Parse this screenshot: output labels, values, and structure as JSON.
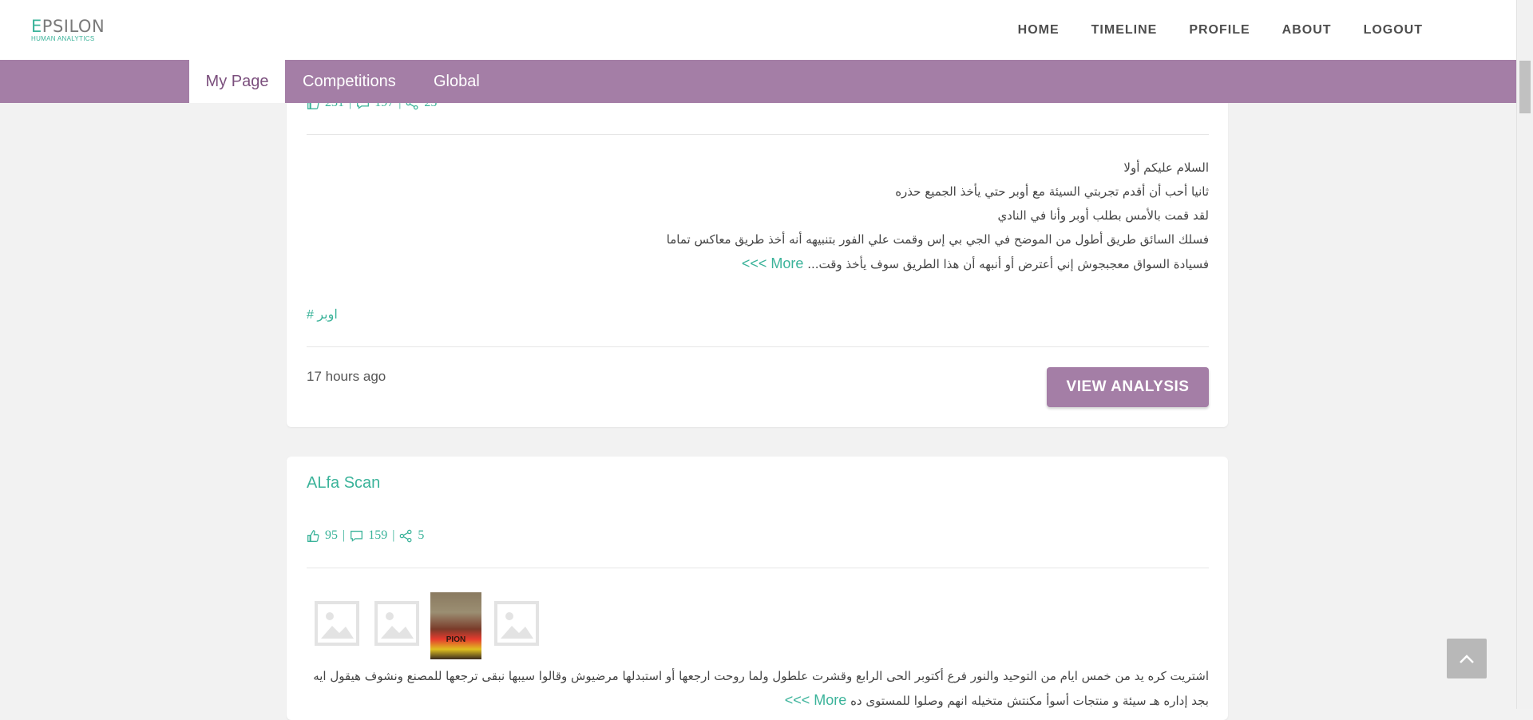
{
  "app": {
    "logo_title_first": "E",
    "logo_title_rest": "PSILON",
    "logo_subtitle": "HUMAN ANALYTICS"
  },
  "nav": {
    "items": [
      "HOME",
      "TIMELINE",
      "PROFILE",
      "ABOUT",
      "LOGOUT"
    ]
  },
  "tabs": [
    {
      "label": "My Page",
      "active": true
    },
    {
      "label": "Competitions",
      "active": false
    },
    {
      "label": "Global",
      "active": false
    }
  ],
  "post1": {
    "likes": "231",
    "comments": "197",
    "shares": "25",
    "lines": [
      "السلام عليكم أولا",
      "ثانيا أحب أن أقدم تجربتي السيئة مع أوبر حتي يأخذ الجميع حذره",
      "لقد قمت بالأمس بطلب أوبر وأنا في النادي",
      "فسلك السائق طريق أطول من الموضح في الجي بي إس وقمت علي الفور بتنبيهه أنه أخذ طريق معاكس تماما",
      "فسيادة السواق معجبجوش إني أعترض أو أنبهه أن هذا الطريق سوف يأخذ وقت..."
    ],
    "more_label": "More >>>",
    "hashtag": "# اوبر",
    "time": "17 hours ago",
    "button_label": "VIEW ANALYSIS"
  },
  "post2": {
    "title": "ALfa Scan",
    "likes": "95",
    "comments": "159",
    "shares": "5",
    "photo_caption": "PION",
    "lines": [
      "اشتريت كره يد من خمس ايام من التوحيد والنور فرع أكتوبر الحى الرابع وقشرت علطول ولما روحت ارجعها أو استبدلها مرضيوش وقالوا سيبها نبقى ترجعها للمصنع ونشوف هيقول ايه",
      "بجد إداره هـ سيئة و منتجات أسوأ مكنتش متخيله انهم وصلوا للمستوى ده"
    ],
    "more_label": "More >>>"
  },
  "colors": {
    "accent": "#3bb39a",
    "brand_purple": "#a47ea6",
    "tab_active_text": "#7b4f7d"
  }
}
